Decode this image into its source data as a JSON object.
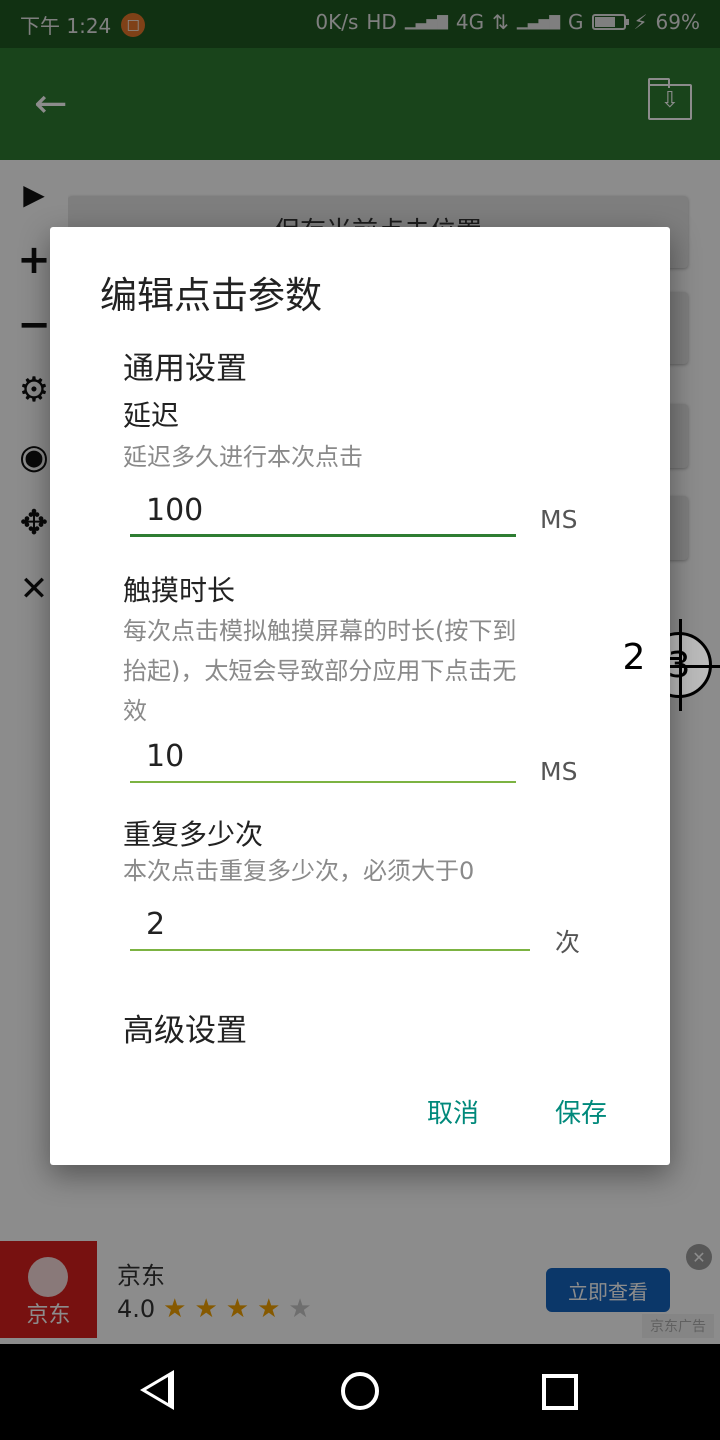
{
  "status_bar": {
    "time": "下午 1:24",
    "notif_glyph": "□",
    "network_speed": "0K/s",
    "hd": "HD",
    "signal_glyph": "▁▃▅▇",
    "net_4g": "4G",
    "arrows": "⇅",
    "carrier_g": "G",
    "charging": "⚡",
    "battery_percent": "69%"
  },
  "app_bar": {
    "back_icon": "←",
    "save_icon": "⇩"
  },
  "background": {
    "button_text": "保存当前点击位置"
  },
  "side_toolbar": {
    "play": "▶",
    "add": "+",
    "remove": "−",
    "settings": "⚙",
    "hide": "◉",
    "move": "✥",
    "close": "✕"
  },
  "targets": {
    "t2": "2",
    "t3": "3"
  },
  "dialog": {
    "title": "编辑点击参数",
    "section_general": "通用设置",
    "delay": {
      "label": "延迟",
      "description": "延迟多久进行本次点击",
      "value": "100",
      "unit": "MS"
    },
    "touch_duration": {
      "label": "触摸时长",
      "description": "每次点击模拟触摸屏幕的时长(按下到抬起)，太短会导致部分应用下点击无效",
      "value": "10",
      "unit": "MS"
    },
    "repeat": {
      "label": "重复多少次",
      "description": "本次点击重复多少次，必须大于0",
      "value": "2",
      "unit": "次"
    },
    "section_advanced": "高级设置",
    "cancel": "取消",
    "save": "保存"
  },
  "ad": {
    "logo_text": "京东",
    "title": "京东",
    "rating": "4.0",
    "stars_filled": 4,
    "stars_total": 5,
    "cta": "立即查看",
    "close": "✕",
    "tag": "京东广告"
  }
}
